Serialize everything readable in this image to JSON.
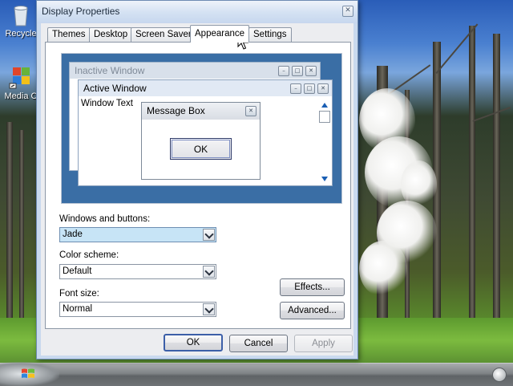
{
  "desktop": {
    "icons": [
      {
        "label": "Recycle",
        "icon": "recycle-bin-icon"
      },
      {
        "label": "Media C",
        "icon": "media-center-icon"
      }
    ]
  },
  "taskbar": {
    "start_icon": "windows-logo-icon",
    "tray_icon": "show-desktop-icon"
  },
  "dialog": {
    "title": "Display Properties",
    "close_glyph": "✕",
    "tabs": [
      {
        "label": "Themes"
      },
      {
        "label": "Desktop"
      },
      {
        "label": "Screen Saver"
      },
      {
        "label": "Appearance",
        "active": true
      },
      {
        "label": "Settings"
      }
    ],
    "preview": {
      "inactive_window_title": "Inactive Window",
      "active_window_title": "Active Window",
      "window_text": "Window Text",
      "message_box_title": "Message Box",
      "message_box_ok": "OK",
      "colors": {
        "desktop": "#3a6ea5",
        "inactive_title": "#d8e0ea",
        "active_title": "#e1e9f4",
        "scroll_arrow": "#1a5fb4"
      }
    },
    "windows_and_buttons": {
      "label": "Windows and buttons:",
      "value": "Jade"
    },
    "color_scheme": {
      "label": "Color scheme:",
      "value": "Default"
    },
    "font_size": {
      "label": "Font size:",
      "value": "Normal"
    },
    "effects_button": "Effects...",
    "advanced_button": "Advanced...",
    "ok_button": "OK",
    "cancel_button": "Cancel",
    "apply_button": "Apply",
    "apply_enabled": false
  }
}
